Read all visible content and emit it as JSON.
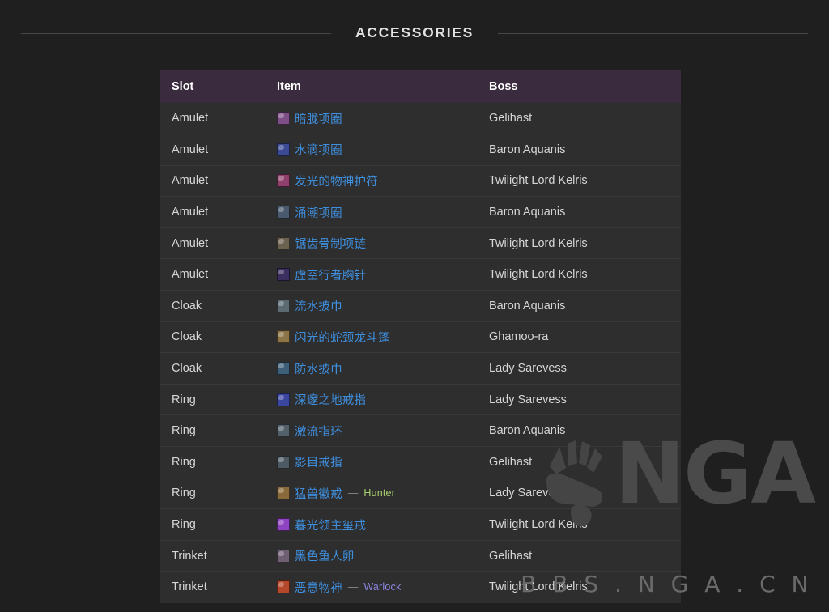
{
  "section": {
    "title": "ACCESSORIES"
  },
  "table": {
    "columns": [
      "Slot",
      "Item",
      "Boss"
    ],
    "rows": [
      {
        "slot": "Amulet",
        "item": "暗胧项圈",
        "item_color": "#3f8fdf",
        "icon_color": "#7d4f86",
        "boss": "Gelihast",
        "class_tag": "",
        "class_color": ""
      },
      {
        "slot": "Amulet",
        "item": "水滴项圈",
        "item_color": "#3f8fdf",
        "icon_color": "#3c4a93",
        "boss": "Baron Aquanis",
        "class_tag": "",
        "class_color": ""
      },
      {
        "slot": "Amulet",
        "item": "发光的物神护符",
        "item_color": "#3f8fdf",
        "icon_color": "#8e3f6b",
        "boss": "Twilight Lord Kelris",
        "class_tag": "",
        "class_color": ""
      },
      {
        "slot": "Amulet",
        "item": "涌潮项圈",
        "item_color": "#3f8fdf",
        "icon_color": "#4a5a6e",
        "boss": "Baron Aquanis",
        "class_tag": "",
        "class_color": ""
      },
      {
        "slot": "Amulet",
        "item": "锯齿骨制项链",
        "item_color": "#3f8fdf",
        "icon_color": "#6b6250",
        "boss": "Twilight Lord Kelris",
        "class_tag": "",
        "class_color": ""
      },
      {
        "slot": "Amulet",
        "item": "虚空行者胸针",
        "item_color": "#3f8fdf",
        "icon_color": "#3a2f5e",
        "boss": "Twilight Lord Kelris",
        "class_tag": "",
        "class_color": ""
      },
      {
        "slot": "Cloak",
        "item": "流水披巾",
        "item_color": "#3f8fdf",
        "icon_color": "#5c6a72",
        "boss": "Baron Aquanis",
        "class_tag": "",
        "class_color": ""
      },
      {
        "slot": "Cloak",
        "item": "闪光的蛇颈龙斗篷",
        "item_color": "#3f8fdf",
        "icon_color": "#8a7448",
        "boss": "Ghamoo-ra",
        "class_tag": "",
        "class_color": ""
      },
      {
        "slot": "Cloak",
        "item": "防水披巾",
        "item_color": "#3f8fdf",
        "icon_color": "#3d5f78",
        "boss": "Lady Sarevess",
        "class_tag": "",
        "class_color": ""
      },
      {
        "slot": "Ring",
        "item": "深邃之地戒指",
        "item_color": "#3f8fdf",
        "icon_color": "#3b46a0",
        "boss": "Lady Sarevess",
        "class_tag": "",
        "class_color": ""
      },
      {
        "slot": "Ring",
        "item": "激流指环",
        "item_color": "#3f8fdf",
        "icon_color": "#53606a",
        "boss": "Baron Aquanis",
        "class_tag": "",
        "class_color": ""
      },
      {
        "slot": "Ring",
        "item": "影目戒指",
        "item_color": "#3f8fdf",
        "icon_color": "#4e5a63",
        "boss": "Gelihast",
        "class_tag": "",
        "class_color": ""
      },
      {
        "slot": "Ring",
        "item": "猛兽徽戒",
        "item_color": "#3f8fdf",
        "icon_color": "#8a6a3a",
        "boss": "Lady Sarevess",
        "class_tag": "Hunter",
        "class_color": "#a9d06f"
      },
      {
        "slot": "Ring",
        "item": "暮光领主玺戒",
        "item_color": "#3f8fdf",
        "icon_color": "#8e44c0",
        "boss": "Twilight Lord Kelris",
        "class_tag": "",
        "class_color": ""
      },
      {
        "slot": "Trinket",
        "item": "黑色鱼人卵",
        "item_color": "#3f8fdf",
        "icon_color": "#6e5f72",
        "boss": "Gelihast",
        "class_tag": "",
        "class_color": ""
      },
      {
        "slot": "Trinket",
        "item": "恶意物神",
        "item_color": "#3f8fdf",
        "icon_color": "#b5472a",
        "boss": "Twilight Lord Kelris",
        "class_tag": "Warlock",
        "class_color": "#8b87e0"
      }
    ]
  },
  "watermark": {
    "logo_text": "NGA",
    "sub_text": "B B S . N G A . C N"
  },
  "colors": {
    "page_bg": "#1f1f1f",
    "row_bg": "#2e2e2e",
    "header_bg": "#3a2b3e",
    "rule": "#464646",
    "item_link": "#3f8fdf",
    "hunter": "#a9d06f",
    "warlock": "#8b87e0"
  }
}
